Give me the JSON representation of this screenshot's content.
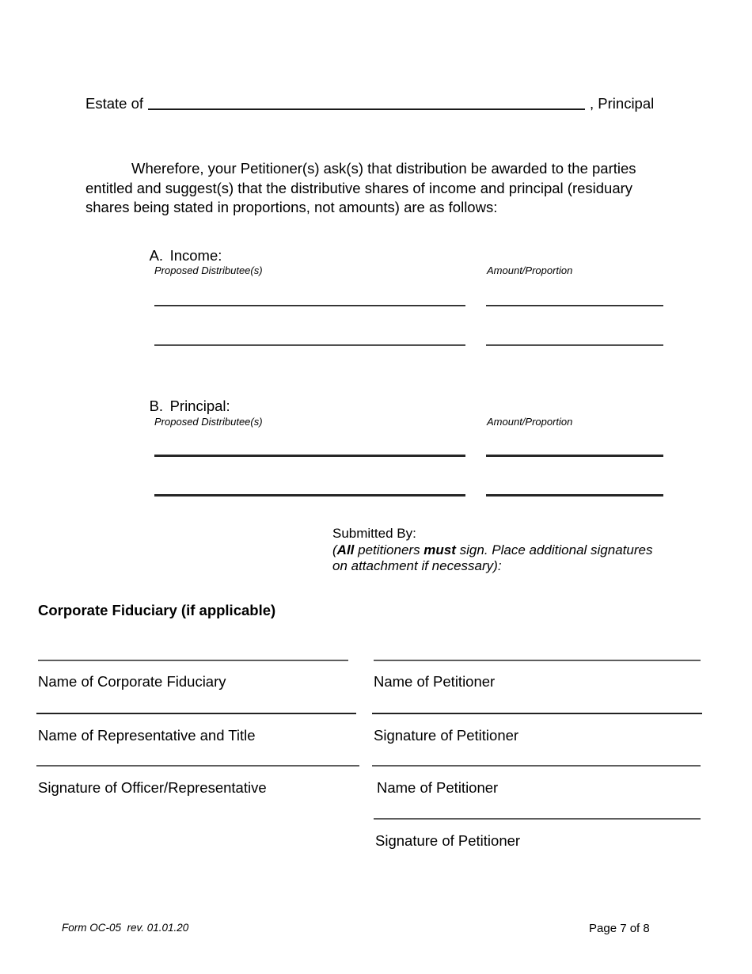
{
  "document": {
    "estate": {
      "prefix": "Estate of",
      "blank_value": "",
      "suffix": ", Principal"
    },
    "wherefore_paragraph": "Wherefore, your Petitioner(s) ask(s) that distribution be awarded to the parties entitled and suggest(s) that the distributive shares of income and principal (residuary shares being stated in proportions, not amounts) are as follows:",
    "sections": [
      {
        "marker": "A.",
        "title": "Income:",
        "column_headers": {
          "distributee": "Proposed Distributee(s)",
          "amount": "Amount/Proportion"
        },
        "rows": [
          {
            "distributee": "",
            "amount": ""
          },
          {
            "distributee": "",
            "amount": ""
          }
        ]
      },
      {
        "marker": "B.",
        "title": "Principal:",
        "column_headers": {
          "distributee": "Proposed Distributee(s)",
          "amount": "Amount/Proportion"
        },
        "rows": [
          {
            "distributee": "",
            "amount": ""
          },
          {
            "distributee": "",
            "amount": ""
          }
        ]
      }
    ],
    "submitted_by": {
      "heading": "Submitted By:",
      "note_open": "(",
      "note_bold_1": "All",
      "note_mid_1": " petitioners ",
      "note_bold_2": "must",
      "note_mid_2": " sign.  Place additional signatures on attachment if necessary):"
    },
    "corporate_fiduciary_heading": "Corporate Fiduciary (if applicable)",
    "signature_fields_left": [
      {
        "label": "Name of Corporate Fiduciary",
        "value": ""
      },
      {
        "label": "Name of Representative and Title",
        "value": ""
      },
      {
        "label": "Signature of Officer/Representative",
        "value": ""
      }
    ],
    "signature_fields_right": [
      {
        "label": "Name of Petitioner",
        "value": ""
      },
      {
        "label": "Signature of Petitioner",
        "value": ""
      },
      {
        "label": "Name of Petitioner",
        "value": ""
      },
      {
        "label": "Signature of Petitioner",
        "value": ""
      }
    ],
    "footer": {
      "form_id": "Form OC-05  rev. 01.01.20",
      "page_number": "Page 7 of 8"
    }
  }
}
